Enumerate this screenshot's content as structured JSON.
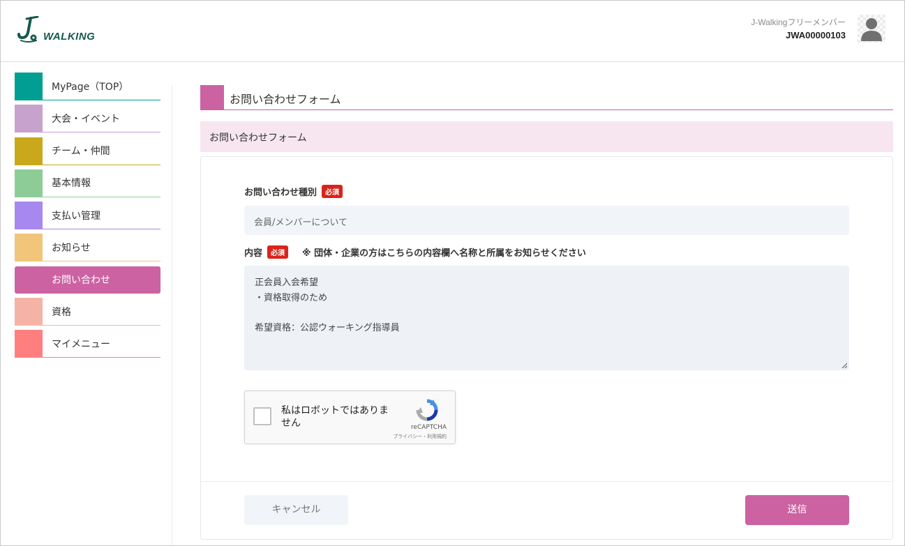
{
  "header": {
    "logo_text": "WALKING",
    "user_name": "J-Walkingフリーメンバー",
    "user_id": "JWA00000103"
  },
  "colors": {
    "brand_green": "#15594c",
    "accent_pink": "#cc62a2",
    "required_red": "#d9241b"
  },
  "sidebar": {
    "items": [
      {
        "label": "MyPage（TOP）",
        "color": "#009e93",
        "active": false
      },
      {
        "label": "大会・イベント",
        "color": "#c7a2cc",
        "active": false
      },
      {
        "label": "チーム・仲間",
        "color": "#c9a81b",
        "active": false
      },
      {
        "label": "基本情報",
        "color": "#8ecc97",
        "active": false
      },
      {
        "label": "支払い管理",
        "color": "#a688f0",
        "active": false
      },
      {
        "label": "お知らせ",
        "color": "#f1c57a",
        "active": false
      },
      {
        "label": "お問い合わせ",
        "color": "#cc62a2",
        "active": true
      },
      {
        "label": "資格",
        "color": "#f5b3a6",
        "active": false
      },
      {
        "label": "マイメニュー",
        "color": "#ff7f7f",
        "active": false
      }
    ]
  },
  "main": {
    "page_title": "お問い合わせフォーム",
    "banner_title": "お問い合わせフォーム",
    "form": {
      "type_label": "お問い合わせ種別",
      "required_badge": "必須",
      "type_value": "会員/メンバーについて",
      "content_label": "内容",
      "content_note": "※ 団体・企業の方はこちらの内容欄へ名称と所属をお知らせください",
      "content_lines": [
        "正会員入会希望",
        "・資格取得のため",
        "",
        "希望資格：公認ウォーキング指導員"
      ]
    },
    "recaptcha": {
      "label": "私はロボットではありません",
      "brand": "reCAPTCHA",
      "links": "プライバシー・利用規約"
    },
    "buttons": {
      "cancel": "キャンセル",
      "submit": "送信"
    }
  }
}
